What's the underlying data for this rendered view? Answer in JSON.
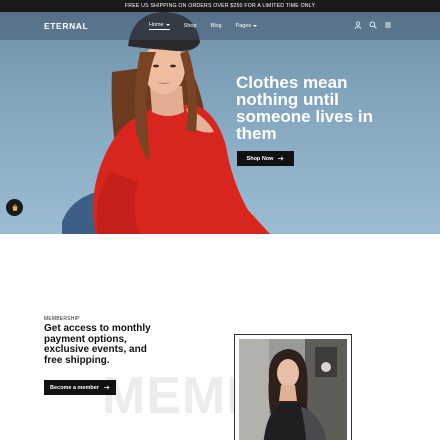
{
  "announcement": "FREE US SHIPPING ON ORDERS OVER $250 FOR A LIMITED TIME ONLY",
  "nav": {
    "logo": "ETERNAL",
    "links": [
      "Home",
      "Shop",
      "Blog",
      "Pages"
    ],
    "icons": [
      "user-icon",
      "search-icon",
      "menu-icon"
    ]
  },
  "hero": {
    "headline": "Clothes mean nothing until someone lives in them",
    "cta": "Shop Now",
    "cta_icon": "arrow-right-icon"
  },
  "fab": {
    "icon": "cart-icon"
  },
  "membership": {
    "label": "MEMBERSHIP",
    "title": "Get access to monthly payment options, exclusive events, and free shipping.",
    "cta": "Become a member",
    "cta_icon": "arrow-right-icon",
    "ghost_text": "MEMBER"
  },
  "colors": {
    "dark": "#111111",
    "hero_bg": "#8fb1c8",
    "sweater": "#d8261f"
  }
}
